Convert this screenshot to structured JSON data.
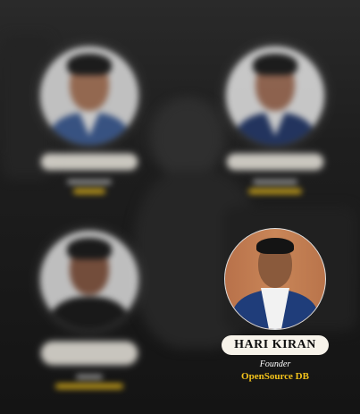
{
  "colors": {
    "background": "#1a1a1a",
    "name_pill": "#f5f1e8",
    "org_text": "#f2c21b",
    "role_text": "#ffffff"
  },
  "featured": {
    "name": "HARI KIRAN",
    "role": "Founder",
    "organization": "OpenSource DB"
  }
}
